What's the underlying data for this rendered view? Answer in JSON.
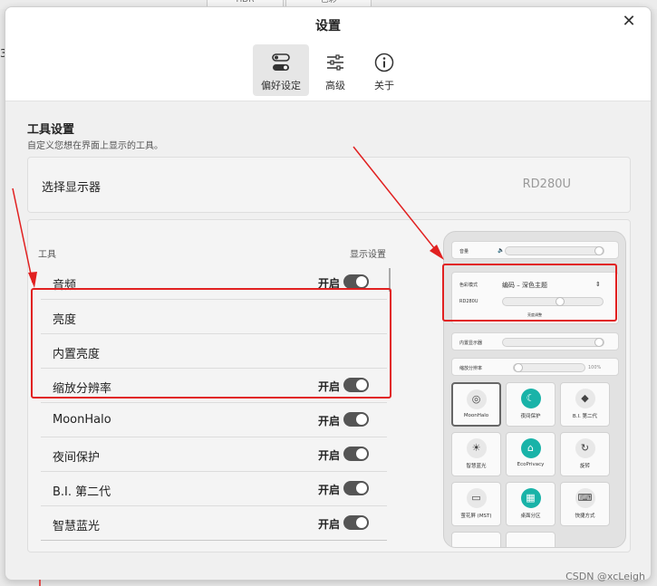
{
  "background": {
    "tab1": "HDR",
    "tab2": "色彩"
  },
  "dialog": {
    "title": "设置",
    "tabs": [
      {
        "label": "偏好设定",
        "icon": "toggles-icon"
      },
      {
        "label": "高级",
        "icon": "sliders-icon"
      },
      {
        "label": "关于",
        "icon": "info-icon"
      }
    ],
    "active_tab": "偏好设定"
  },
  "tool_settings": {
    "title": "工具设置",
    "subtitle": "自定义您想在界面上显示的工具。",
    "monitor_label": "选择显示器",
    "monitor_value": "RD280U",
    "col_tool": "工具",
    "col_display": "显示设置",
    "rows": [
      {
        "name": "音频",
        "state": "开启",
        "toggle": true
      },
      {
        "name": "亮度",
        "state": "",
        "toggle": false
      },
      {
        "name": "内置亮度",
        "state": "",
        "toggle": false
      },
      {
        "name": "缩放分辨率",
        "state": "开启",
        "toggle": true
      },
      {
        "name": "MoonHalo",
        "state": "开启",
        "toggle": true
      },
      {
        "name": "夜间保护",
        "state": "开启",
        "toggle": true
      },
      {
        "name": "B.I. 第二代",
        "state": "开启",
        "toggle": true
      },
      {
        "name": "智慧蓝光",
        "state": "开启",
        "toggle": true
      }
    ]
  },
  "preview": {
    "volume_label": "音量",
    "color_mode_label": "色彩模式",
    "color_mode_value": "编码 – 深色主题",
    "monitor_name": "RD280U",
    "brightness_caption": "亮度调整",
    "builtin_label": "内置显示器",
    "scale_label": "缩放分辨率",
    "scale_value": "100%",
    "tiles": [
      {
        "label": "MoonHalo",
        "glyph": "◎"
      },
      {
        "label": "夜间保护",
        "glyph": "☾"
      },
      {
        "label": "B.I. 第二代",
        "glyph": "◆"
      },
      {
        "label": "智慧蓝光",
        "glyph": "☀"
      },
      {
        "label": "EcoPrivacy",
        "glyph": "⌂"
      },
      {
        "label": "旋转",
        "glyph": "↻"
      },
      {
        "label": "萤花屏 (MST)",
        "glyph": "▭"
      },
      {
        "label": "桌面分区",
        "glyph": "▦"
      },
      {
        "label": "快捷方式",
        "glyph": "⌨"
      }
    ]
  },
  "watermark": "CSDN @xcLeigh",
  "colors": {
    "annotation": "#e12020",
    "accent": "#19b3a8",
    "toggle_on": "#555555"
  }
}
